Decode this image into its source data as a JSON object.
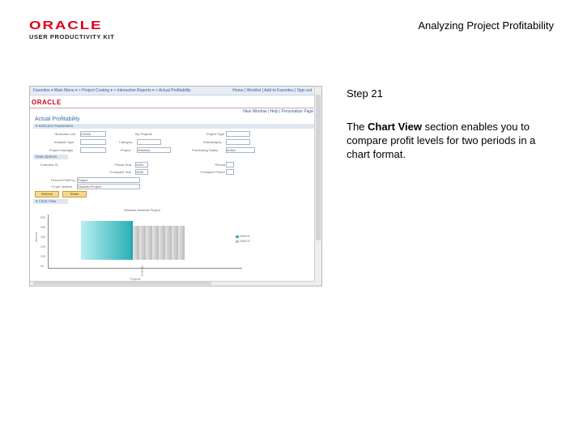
{
  "header": {
    "logo_word": "ORACLE",
    "logo_sub": "USER PRODUCTIVITY KIT",
    "doc_title": "Analyzing Project Profitability"
  },
  "step": {
    "title": "Step 21",
    "text_before": "The ",
    "text_bold": "Chart View",
    "text_after": " section enables you to compare profit levels for two periods in a chart format."
  },
  "screenshot": {
    "breadcrumb": "Favorites ▾  Main Menu ▾  > Project Costing ▾ > Interactive Reports ▾ > Actual Profitability",
    "top_links": "Home | Worklist | Add to Favorites | Sign out",
    "oracle": "ORACLE",
    "right_links": "New Window | Help | Personalize Page",
    "page_title": "Actual Profitability",
    "section1": "▾ Selection Parameters",
    "section2": "Data Options",
    "section3": "▾ Chart View",
    "labels": {
      "business_unit": "*Business Unit",
      "my_projects": "My Projects",
      "project_type": "Project Type",
      "analysis_type": "Analysis Type",
      "category": "Category",
      "subcategory": "Subcategory",
      "project_manager": "Project Manager",
      "project": "Project",
      "processing_status": "Processing Status",
      "calendar_id": "*Calendar ID",
      "fiscal_year": "*Fiscal Year",
      "period": "*Period",
      "compare_fiscal_year": "*Compare Year",
      "compare_period": "*Compare Period",
      "percent_profit": "Percent Profit by",
      "chart_options": "*Chart Options"
    },
    "values": {
      "business_unit": "US004",
      "project": "Wireless",
      "processing_status": "Active",
      "fiscal_year": "2009",
      "compare_fiscal_year": "2008",
      "percent_profit": "Project",
      "chart_options": "Selected Project"
    },
    "buttons": {
      "refresh": "Refresh",
      "reset": "Reset"
    },
    "chart": {
      "title": "Wireless Network Project",
      "x_label": "Projects",
      "y_label": "Amount",
      "bar_label": "Wireless",
      "ticks": [
        "50K",
        "40K",
        "30K",
        "20K",
        "10K",
        "0K"
      ],
      "legend": [
        "2009-01",
        "2008-12"
      ]
    }
  },
  "colors": {
    "oracle_red": "#e0001b",
    "bar1": "#2fb3b8",
    "bar2": "#bdbdbd"
  }
}
